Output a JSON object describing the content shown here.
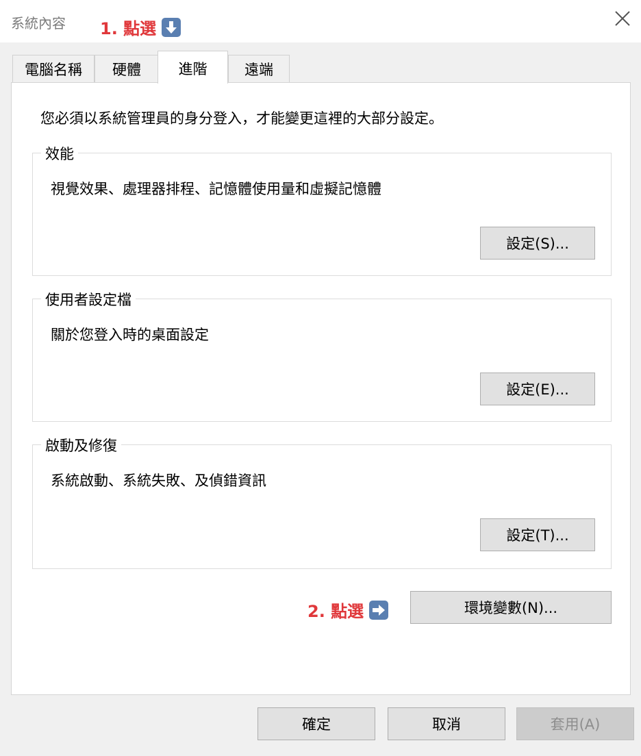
{
  "window": {
    "title": "系統內容",
    "close_icon": "close-icon"
  },
  "annotations": {
    "step1_label": "1. 點選",
    "step1_icon": "down-arrow-icon",
    "step2_label": "2. 點選",
    "step2_icon": "right-arrow-icon",
    "color": "#e0383b",
    "icon_bg": "#5a7fb1"
  },
  "tabs": [
    {
      "label": "電腦名稱"
    },
    {
      "label": "硬體"
    },
    {
      "label": "進階",
      "selected": true
    },
    {
      "label": "遠端"
    }
  ],
  "content": {
    "intro": "您必須以系統管理員的身分登入，才能變更這裡的大部分設定。",
    "groups": [
      {
        "title": "效能",
        "description": "視覺效果、處理器排程、記憶體使用量和虛擬記憶體",
        "button": "設定(S)..."
      },
      {
        "title": "使用者設定檔",
        "description": "關於您登入時的桌面設定",
        "button": "設定(E)..."
      },
      {
        "title": "啟動及修復",
        "description": "系統啟動、系統失敗、及偵錯資訊",
        "button": "設定(T)..."
      }
    ],
    "env_button": "環境變數(N)..."
  },
  "footer": {
    "ok": "確定",
    "cancel": "取消",
    "apply": "套用(A)"
  }
}
